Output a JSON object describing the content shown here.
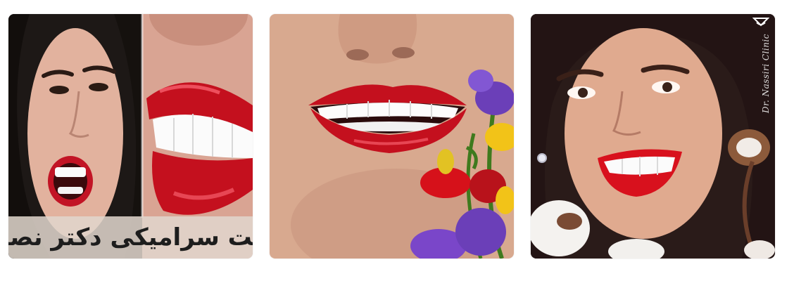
{
  "gallery": {
    "items": [
      {
        "id": "1",
        "caption": "لمینت سرامیکی دکتر نصیری",
        "subject": "before-after-ceramic-veneer-smile"
      },
      {
        "id": "2",
        "subject": "smile-with-flowers"
      },
      {
        "id": "3",
        "watermark": "Dr. Nassiri Clinic",
        "subject": "woman-smiling-with-cotton-flowers"
      }
    ]
  },
  "colors": {
    "lipstick": "#c4101e",
    "lipstick_highlight": "#ff6b78",
    "background": "#ffffff",
    "caption_band": "#e1d6cd",
    "flower_purple": "#6b3fb8",
    "flower_red": "#d6111a",
    "flower_yellow": "#f2c318"
  }
}
